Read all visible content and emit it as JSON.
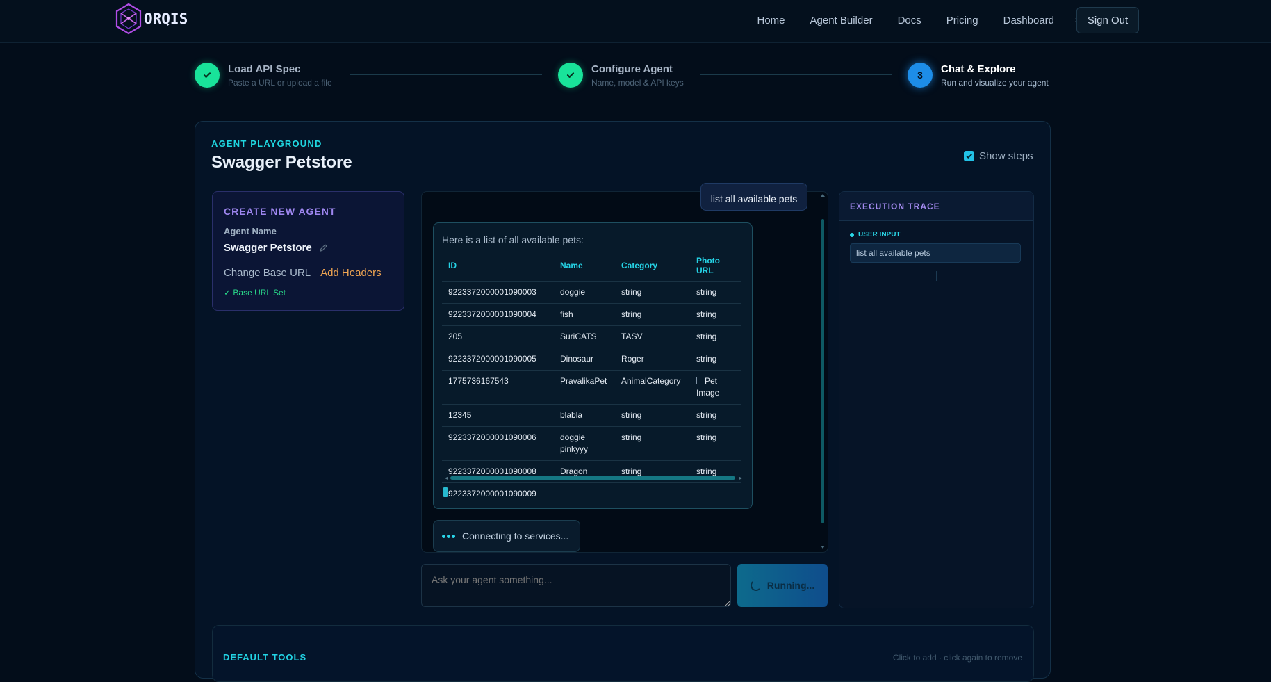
{
  "brand": {
    "name": "ORQIS"
  },
  "nav": {
    "items": [
      "Home",
      "Agent Builder",
      "Docs",
      "Pricing",
      "Dashboard"
    ],
    "sign_out": "Sign Out"
  },
  "steps": [
    {
      "title": "Load API Spec",
      "subtitle": "Paste a URL or upload a file",
      "state": "done"
    },
    {
      "title": "Configure Agent",
      "subtitle": "Name, model & API keys",
      "state": "done"
    },
    {
      "number": "3",
      "title": "Chat & Explore",
      "subtitle": "Run and visualize your agent",
      "state": "active"
    }
  ],
  "playground": {
    "eyebrow": "AGENT PLAYGROUND",
    "title": "Swagger Petstore",
    "show_steps_label": "Show steps",
    "show_steps_checked": true
  },
  "create_agent": {
    "heading": "CREATE NEW AGENT",
    "name_label": "Agent Name",
    "name_value": "Swagger Petstore",
    "change_base_url": "Change Base URL",
    "add_headers": "Add Headers",
    "base_url_status": "✓ Base URL Set"
  },
  "chat": {
    "user_message": "list all available pets",
    "bot_intro": "Here is a list of all available pets:",
    "table": {
      "headers": [
        "ID",
        "Name",
        "Category",
        "Photo URL"
      ],
      "rows": [
        [
          "9223372000001090003",
          "doggie",
          "string",
          "string"
        ],
        [
          "9223372000001090004",
          "fish",
          "string",
          "string"
        ],
        [
          "205",
          "SuriCATS",
          "TASV",
          "string"
        ],
        [
          "9223372000001090005",
          "Dinosaur",
          "Roger",
          "string"
        ],
        [
          "1775736167543",
          "PravalikaPet",
          "AnimalCategory",
          "Pet Image"
        ],
        [
          "12345",
          "blabla",
          "string",
          "string"
        ],
        [
          "9223372000001090006",
          "doggie pinkyyy",
          "string",
          "string"
        ],
        [
          "9223372000001090008",
          "Dragon",
          "string",
          "string"
        ],
        [
          "9223372000001090009",
          "",
          "",
          ""
        ]
      ]
    },
    "status": "Connecting to services...",
    "input_placeholder": "Ask your agent something...",
    "run_button": "Running..."
  },
  "trace": {
    "heading": "EXECUTION TRACE",
    "user_input_label": "USER INPUT",
    "user_input_value": "list all available pets"
  },
  "tools": {
    "heading": "DEFAULT TOOLS",
    "hint": "Click to add · click again to remove"
  },
  "colors": {
    "background": "#030d1a",
    "accent_cyan": "#1fd6e0",
    "accent_purple": "#9e86ef",
    "success_green": "#19e39a",
    "active_blue": "#1d8de8",
    "warning_orange": "#f0a552"
  }
}
